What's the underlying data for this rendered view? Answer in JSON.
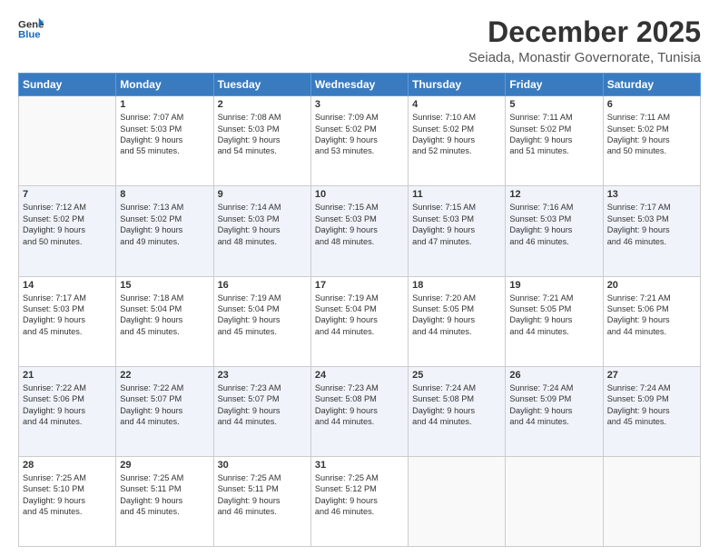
{
  "logo": {
    "line1": "General",
    "line2": "Blue"
  },
  "title": "December 2025",
  "location": "Seiada, Monastir Governorate, Tunisia",
  "weekdays": [
    "Sunday",
    "Monday",
    "Tuesday",
    "Wednesday",
    "Thursday",
    "Friday",
    "Saturday"
  ],
  "weeks": [
    [
      {
        "day": "",
        "info": ""
      },
      {
        "day": "1",
        "info": "Sunrise: 7:07 AM\nSunset: 5:03 PM\nDaylight: 9 hours\nand 55 minutes."
      },
      {
        "day": "2",
        "info": "Sunrise: 7:08 AM\nSunset: 5:03 PM\nDaylight: 9 hours\nand 54 minutes."
      },
      {
        "day": "3",
        "info": "Sunrise: 7:09 AM\nSunset: 5:02 PM\nDaylight: 9 hours\nand 53 minutes."
      },
      {
        "day": "4",
        "info": "Sunrise: 7:10 AM\nSunset: 5:02 PM\nDaylight: 9 hours\nand 52 minutes."
      },
      {
        "day": "5",
        "info": "Sunrise: 7:11 AM\nSunset: 5:02 PM\nDaylight: 9 hours\nand 51 minutes."
      },
      {
        "day": "6",
        "info": "Sunrise: 7:11 AM\nSunset: 5:02 PM\nDaylight: 9 hours\nand 50 minutes."
      }
    ],
    [
      {
        "day": "7",
        "info": "Sunrise: 7:12 AM\nSunset: 5:02 PM\nDaylight: 9 hours\nand 50 minutes."
      },
      {
        "day": "8",
        "info": "Sunrise: 7:13 AM\nSunset: 5:02 PM\nDaylight: 9 hours\nand 49 minutes."
      },
      {
        "day": "9",
        "info": "Sunrise: 7:14 AM\nSunset: 5:03 PM\nDaylight: 9 hours\nand 48 minutes."
      },
      {
        "day": "10",
        "info": "Sunrise: 7:15 AM\nSunset: 5:03 PM\nDaylight: 9 hours\nand 48 minutes."
      },
      {
        "day": "11",
        "info": "Sunrise: 7:15 AM\nSunset: 5:03 PM\nDaylight: 9 hours\nand 47 minutes."
      },
      {
        "day": "12",
        "info": "Sunrise: 7:16 AM\nSunset: 5:03 PM\nDaylight: 9 hours\nand 46 minutes."
      },
      {
        "day": "13",
        "info": "Sunrise: 7:17 AM\nSunset: 5:03 PM\nDaylight: 9 hours\nand 46 minutes."
      }
    ],
    [
      {
        "day": "14",
        "info": "Sunrise: 7:17 AM\nSunset: 5:03 PM\nDaylight: 9 hours\nand 45 minutes."
      },
      {
        "day": "15",
        "info": "Sunrise: 7:18 AM\nSunset: 5:04 PM\nDaylight: 9 hours\nand 45 minutes."
      },
      {
        "day": "16",
        "info": "Sunrise: 7:19 AM\nSunset: 5:04 PM\nDaylight: 9 hours\nand 45 minutes."
      },
      {
        "day": "17",
        "info": "Sunrise: 7:19 AM\nSunset: 5:04 PM\nDaylight: 9 hours\nand 44 minutes."
      },
      {
        "day": "18",
        "info": "Sunrise: 7:20 AM\nSunset: 5:05 PM\nDaylight: 9 hours\nand 44 minutes."
      },
      {
        "day": "19",
        "info": "Sunrise: 7:21 AM\nSunset: 5:05 PM\nDaylight: 9 hours\nand 44 minutes."
      },
      {
        "day": "20",
        "info": "Sunrise: 7:21 AM\nSunset: 5:06 PM\nDaylight: 9 hours\nand 44 minutes."
      }
    ],
    [
      {
        "day": "21",
        "info": "Sunrise: 7:22 AM\nSunset: 5:06 PM\nDaylight: 9 hours\nand 44 minutes."
      },
      {
        "day": "22",
        "info": "Sunrise: 7:22 AM\nSunset: 5:07 PM\nDaylight: 9 hours\nand 44 minutes."
      },
      {
        "day": "23",
        "info": "Sunrise: 7:23 AM\nSunset: 5:07 PM\nDaylight: 9 hours\nand 44 minutes."
      },
      {
        "day": "24",
        "info": "Sunrise: 7:23 AM\nSunset: 5:08 PM\nDaylight: 9 hours\nand 44 minutes."
      },
      {
        "day": "25",
        "info": "Sunrise: 7:24 AM\nSunset: 5:08 PM\nDaylight: 9 hours\nand 44 minutes."
      },
      {
        "day": "26",
        "info": "Sunrise: 7:24 AM\nSunset: 5:09 PM\nDaylight: 9 hours\nand 44 minutes."
      },
      {
        "day": "27",
        "info": "Sunrise: 7:24 AM\nSunset: 5:09 PM\nDaylight: 9 hours\nand 45 minutes."
      }
    ],
    [
      {
        "day": "28",
        "info": "Sunrise: 7:25 AM\nSunset: 5:10 PM\nDaylight: 9 hours\nand 45 minutes."
      },
      {
        "day": "29",
        "info": "Sunrise: 7:25 AM\nSunset: 5:11 PM\nDaylight: 9 hours\nand 45 minutes."
      },
      {
        "day": "30",
        "info": "Sunrise: 7:25 AM\nSunset: 5:11 PM\nDaylight: 9 hours\nand 46 minutes."
      },
      {
        "day": "31",
        "info": "Sunrise: 7:25 AM\nSunset: 5:12 PM\nDaylight: 9 hours\nand 46 minutes."
      },
      {
        "day": "",
        "info": ""
      },
      {
        "day": "",
        "info": ""
      },
      {
        "day": "",
        "info": ""
      }
    ]
  ]
}
